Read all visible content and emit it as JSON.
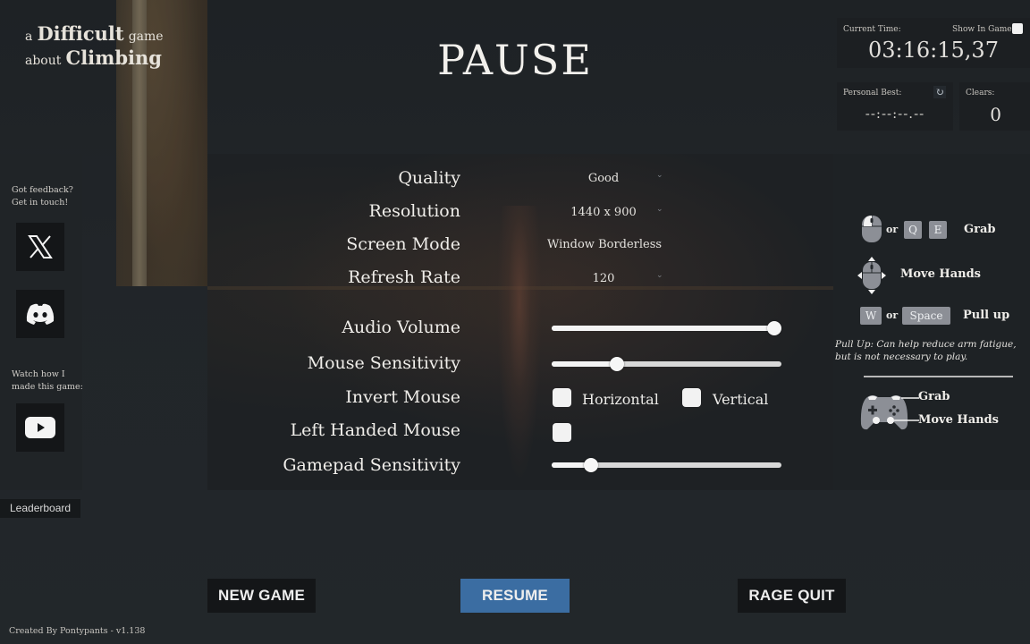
{
  "logo": {
    "word_a": "a",
    "word_difficult": "Difficult",
    "word_game": "game",
    "word_about": "about",
    "word_climbing": "Climbing"
  },
  "title": "PAUSE",
  "timer": {
    "current_time_label": "Current Time:",
    "show_in_game_label": "Show In Game",
    "show_in_game_checked": false,
    "current_time": "03:16:15,37",
    "personal_best_label": "Personal Best:",
    "personal_best": "--:--:--.--",
    "reset_icon": "refresh-icon",
    "clears_label": "Clears:",
    "clears": "0"
  },
  "sidebar": {
    "feedback_text_1": "Got feedback?",
    "feedback_text_2": "Get in touch!",
    "social": [
      {
        "name": "x-twitter",
        "icon": "x-logo-icon"
      },
      {
        "name": "discord",
        "icon": "discord-logo-icon"
      }
    ],
    "watch_text_1": "Watch how I",
    "watch_text_2": "made this game:",
    "video": {
      "name": "youtube",
      "icon": "youtube-logo-icon"
    },
    "leaderboard_label": "Leaderboard"
  },
  "settings": {
    "quality": {
      "label": "Quality",
      "value": "Good"
    },
    "resolution": {
      "label": "Resolution",
      "value": "1440 x 900"
    },
    "screen_mode": {
      "label": "Screen Mode",
      "value": "Window Borderless"
    },
    "refresh_rate": {
      "label": "Refresh Rate",
      "value": "120"
    },
    "audio_volume": {
      "label": "Audio Volume",
      "value": 1.0
    },
    "mouse_sensitivity": {
      "label": "Mouse Sensitivity",
      "value": 0.27
    },
    "invert_mouse": {
      "label": "Invert Mouse",
      "horizontal_label": "Horizontal",
      "horizontal_checked": false,
      "vertical_label": "Vertical",
      "vertical_checked": false
    },
    "left_handed_mouse": {
      "label": "Left Handed Mouse",
      "checked": false
    },
    "gamepad_sensitivity": {
      "label": "Gamepad Sensitivity",
      "value": 0.15
    }
  },
  "controls_help": {
    "or": "or",
    "grab_key_1": "Q",
    "grab_key_2": "E",
    "grab_label": "Grab",
    "move_hands_label": "Move Hands",
    "pull_key_1": "W",
    "pull_key_2": "Space",
    "pull_label": "Pull up",
    "note_line_1": "Pull Up: Can help reduce arm fatigue,",
    "note_line_2": "but is not necessary to play.",
    "gamepad_grab_label": "Grab",
    "gamepad_move_label": "Move Hands"
  },
  "buttons": {
    "new_game": "NEW GAME",
    "resume": "RESUME",
    "rage_quit": "RAGE QUIT"
  },
  "credit": "Created By Pontypants - v1.138",
  "colors": {
    "resume_button": "#3b6da2",
    "dark_button": "#141618",
    "background": "#202428",
    "key_cap": "#8c8f96"
  }
}
